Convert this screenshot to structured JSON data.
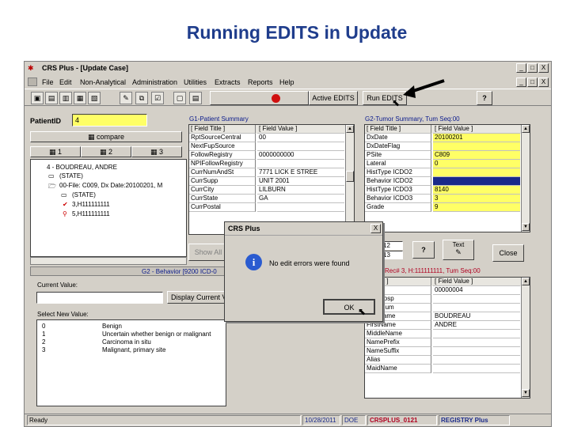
{
  "slide": {
    "title": "Running EDITS in Update"
  },
  "window": {
    "title": "CRS Plus - [Update Case]",
    "controls": {
      "min": "_",
      "max": "□",
      "close": "X"
    },
    "menu": [
      "File",
      "Edit",
      "Non-Analytical",
      "Administration",
      "Utilities",
      "Extracts",
      "Reports",
      "Help"
    ],
    "toolbar": {
      "active_edits": "Active EDITS",
      "run_edits": "Run EDITS",
      "help_glyph": "?"
    }
  },
  "patient_panel": {
    "label": "PatientID",
    "value": "4",
    "compare": "compare",
    "tabs": [
      "1",
      "2",
      "3"
    ],
    "tree": [
      "4 - BOUDREAU, ANDRE",
      "(STATE)",
      "00-File: C009, Dx Date:20100201, M",
      "(STATE)",
      "3,H111111111",
      "5,H111111111"
    ]
  },
  "summary_panel": {
    "title": "G1-Patient Summary",
    "headers": [
      "[ Field Title ]",
      "[ Field Value ]"
    ],
    "rows": [
      [
        "RptSourceCentral",
        "00"
      ],
      [
        "NextFupSource",
        ""
      ],
      [
        "FollowRegistry",
        "0000000000"
      ],
      [
        "NPIFollowRegistry",
        ""
      ],
      [
        "CurrNumAndSt",
        "7771 LICK E STREE"
      ],
      [
        "CurrSupp",
        "UNIT 2001"
      ],
      [
        "CurrCity",
        "LILBURN"
      ],
      [
        "CurrState",
        "GA"
      ],
      [
        "CurrPostal",
        ""
      ]
    ],
    "show_all": "Show All"
  },
  "tumor_panel": {
    "title": "G2-Tumor Summary, Tum Seq:00",
    "headers": [
      "[ Field Title ]",
      "[ Field Value ]"
    ],
    "rows": [
      [
        "DxDate",
        "20100201"
      ],
      [
        "DxDateFlag",
        ""
      ],
      [
        "PSite",
        "C809"
      ],
      [
        "Lateral",
        "0"
      ],
      [
        "HistType ICDO2",
        ""
      ],
      [
        "Behavior ICDO2",
        ""
      ],
      [
        "HistType ICDO3",
        "8140"
      ],
      [
        "Behavior ICDO3",
        "3"
      ],
      [
        "Grade",
        "9"
      ]
    ],
    "spin1": "12",
    "spin2": "13",
    "text_btn": "Text",
    "close_btn": "Close"
  },
  "behavior_panel": {
    "title": "G2 - Behavior [9200 ICD-0",
    "current_value_label": "Current Value:",
    "display_current": "Display Current V",
    "select_new_label": "Select New Value:",
    "options": [
      [
        "0",
        "Benign"
      ],
      [
        "1",
        "Uncertain whether benign or malignant"
      ],
      [
        "2",
        "Carcinoma in situ"
      ],
      [
        "3",
        "Malignant, primary site"
      ]
    ]
  },
  "fields_panel": {
    "title": "Rec# 3, H:111111111, Tum Seq:00",
    "headers": [
      "ld Title ]",
      "[ Field Value ]"
    ],
    "rows": [
      [
        "ntID",
        "00000004"
      ],
      [
        "ltelDHosp",
        ""
      ],
      [
        "etentNum",
        ""
      ],
      [
        "LastName",
        "BOUDREAU"
      ],
      [
        "FirstName",
        "ANDRE"
      ],
      [
        "MiddleName",
        ""
      ],
      [
        "NamePrefix",
        ""
      ],
      [
        "NameSuffix",
        ""
      ],
      [
        "Alias",
        ""
      ],
      [
        "MaidName",
        ""
      ]
    ]
  },
  "dialog": {
    "title": "CRS Plus",
    "close": "X",
    "message": "No edit errors were found",
    "ok": "OK"
  },
  "status_bar": {
    "ready": "Ready",
    "date": "10/28/2011",
    "user": "DOE",
    "db": "CRSPLUS_0121",
    "app": "REGISTRY Plus"
  },
  "colors": {
    "title_blue": "#1f3d8c",
    "highlight_yellow": "#ffff66",
    "selected_row": "#1a2a8a",
    "panel_title": "#0a1a8c",
    "status_red": "#b00020"
  }
}
